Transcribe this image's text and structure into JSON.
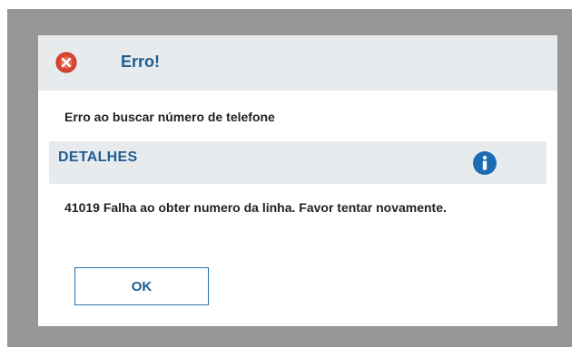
{
  "dialog": {
    "title": "Erro!",
    "title_icon": "error-icon",
    "message": "Erro ao buscar número de telefone",
    "details": {
      "heading": "DETALHES",
      "icon": "info-icon",
      "text": "41019 Falha ao obter numero da linha. Favor tentar novamente."
    },
    "ok_label": "OK"
  },
  "colors": {
    "backdrop": "#969696",
    "header_bg": "#e8ebee",
    "accent": "#1f5d93",
    "error_red": "#d9452f",
    "info_blue": "#1d6bb3"
  }
}
